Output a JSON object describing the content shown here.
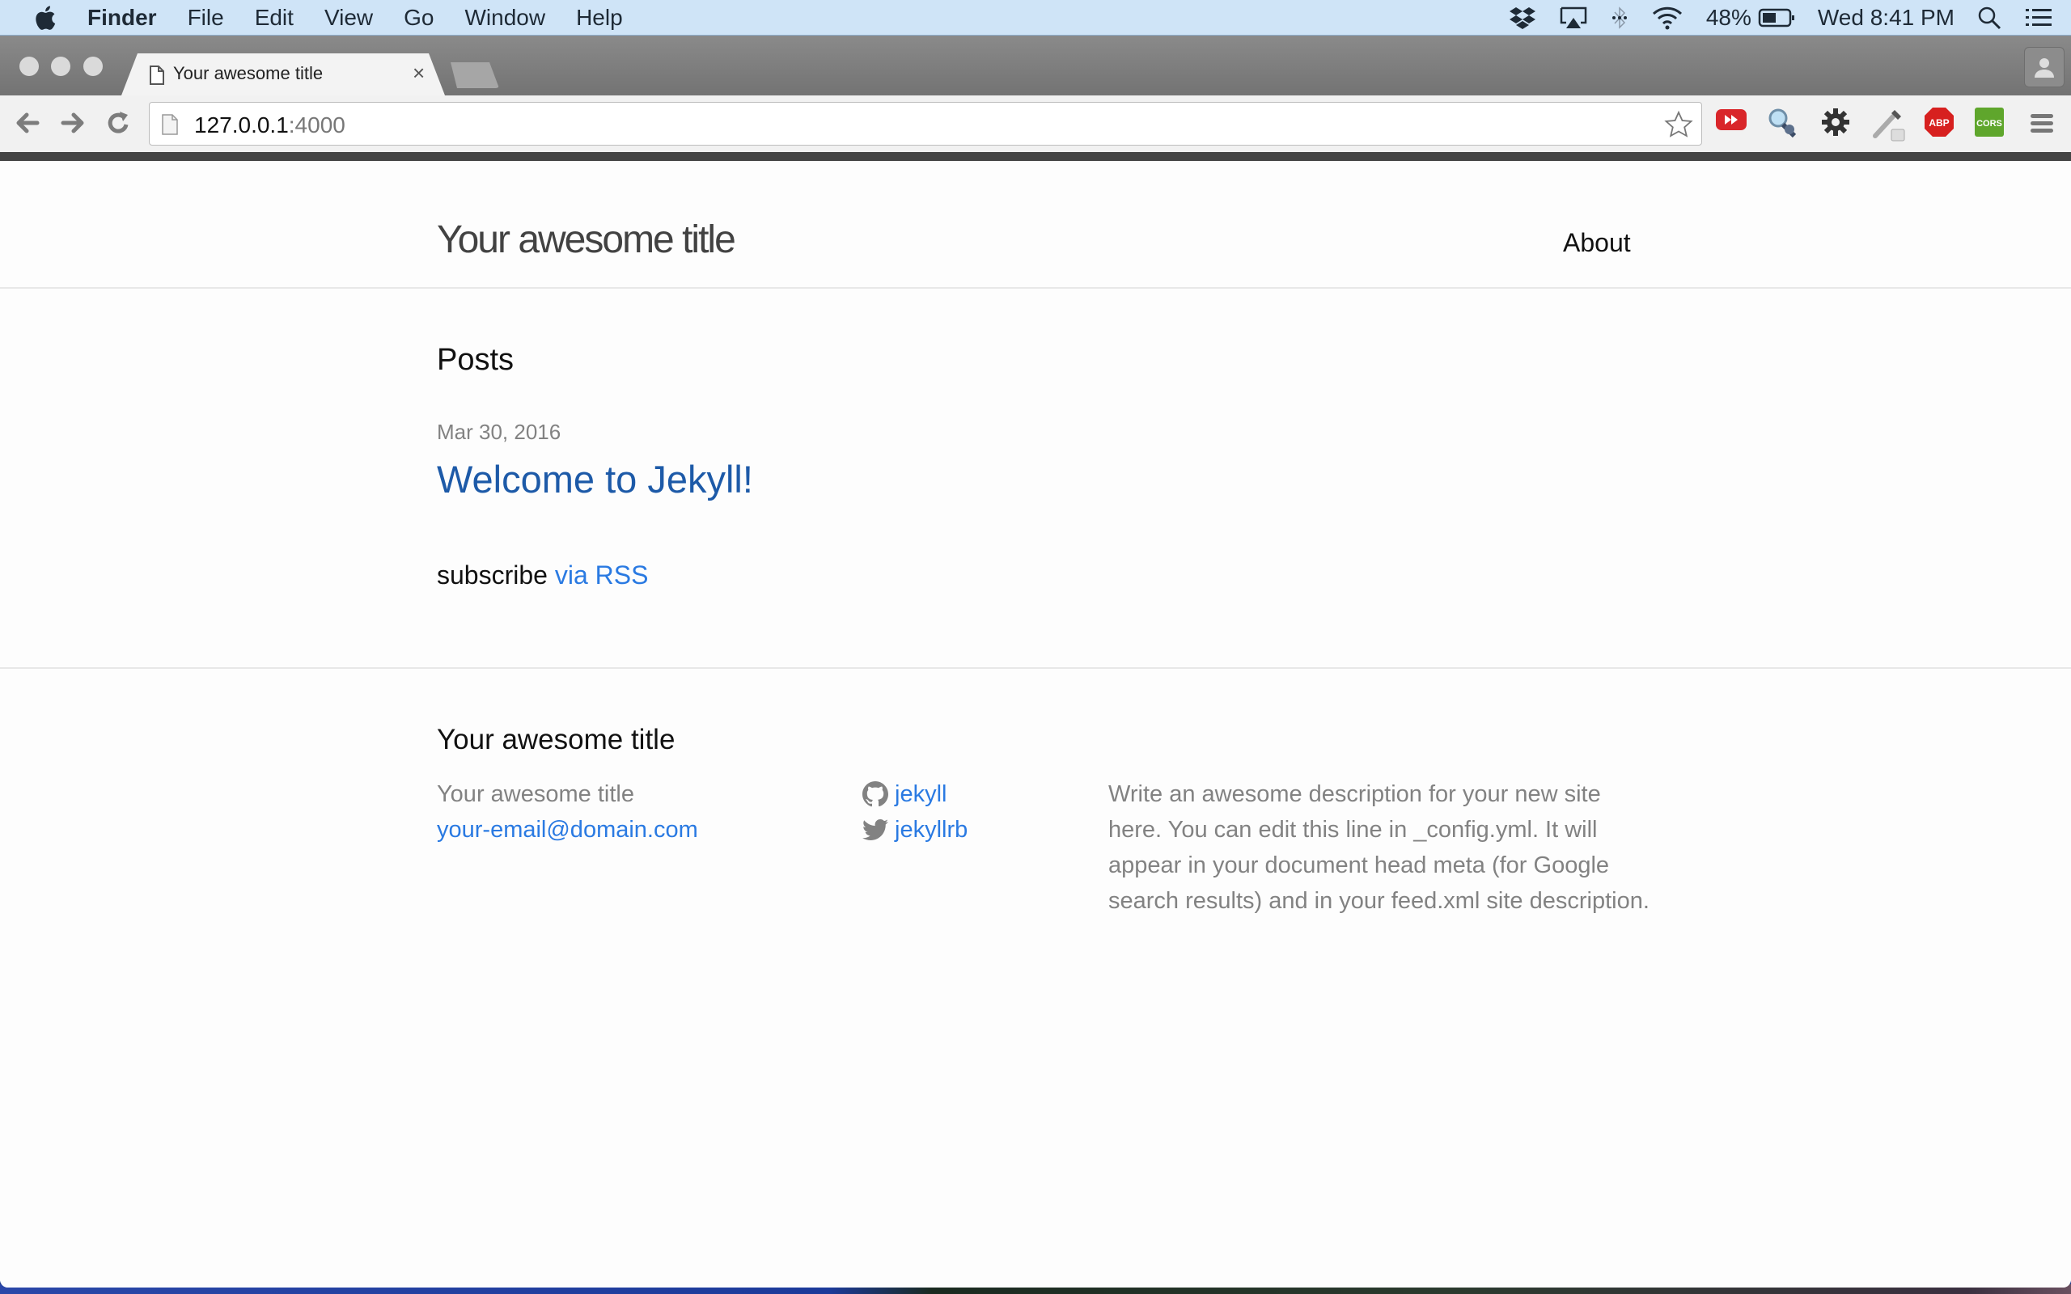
{
  "menubar": {
    "app": "Finder",
    "items": [
      "File",
      "Edit",
      "View",
      "Go",
      "Window",
      "Help"
    ],
    "battery": "48%",
    "clock": "Wed 8:41 PM"
  },
  "browser": {
    "tab_title": "Your awesome title",
    "tab_close": "×",
    "url_host": "127.0.0.1",
    "url_port": ":4000",
    "extensions": [
      "youtube-fast-forward",
      "inspector",
      "settings",
      "color-picker",
      "ABP",
      "CORS"
    ]
  },
  "site": {
    "title": "Your awesome title",
    "nav": [
      {
        "label": "About"
      }
    ],
    "posts_heading": "Posts",
    "posts": [
      {
        "date": "Mar 30, 2016",
        "title": "Welcome to Jekyll!"
      }
    ],
    "subscribe_prefix": "subscribe",
    "subscribe_link": "via RSS",
    "colors": {
      "link": "#2a7ae2",
      "post_link": "#1d5aa8",
      "muted": "#828282"
    }
  },
  "footer": {
    "heading": "Your awesome title",
    "name": "Your awesome title",
    "email": "your-email@domain.com",
    "github": "jekyll",
    "twitter": "jekyllrb",
    "description": "Write an awesome description for your new site here. You can edit this line in _config.yml. It will appear in your document head meta (for Google search results) and in your feed.xml site description."
  }
}
